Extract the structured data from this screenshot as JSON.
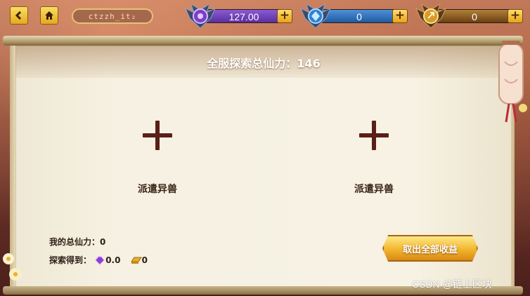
{
  "topbar": {
    "back_icon": "chevron-left-icon",
    "home_icon": "home-icon",
    "title": "ctzzh_it₂"
  },
  "currencies": [
    {
      "icon": "purple-gem-emblem",
      "value": "127.00",
      "color": "#6a3fb0"
    },
    {
      "icon": "blue-gem-emblem",
      "value": "0",
      "color": "#2f6fb8"
    },
    {
      "icon": "gold-coin-emblem",
      "value": "0",
      "color": "#8a5a1a"
    }
  ],
  "panel": {
    "total_power_label": "全服探索总仙力：146",
    "slots": [
      {
        "label": "派遣异兽"
      },
      {
        "label": "派遣异兽"
      }
    ],
    "my_power_label": "我的总仙力：0",
    "explore_label": "探索得到：",
    "reward_purple": "0.0",
    "reward_gold": "0",
    "collect_button": "取出全部收益"
  },
  "watermark": "CSDN @链上区块",
  "colors": {
    "accent_gold": "#f2b52c",
    "text_dark": "#3b2418",
    "plus_mark": "#5a1f18"
  }
}
